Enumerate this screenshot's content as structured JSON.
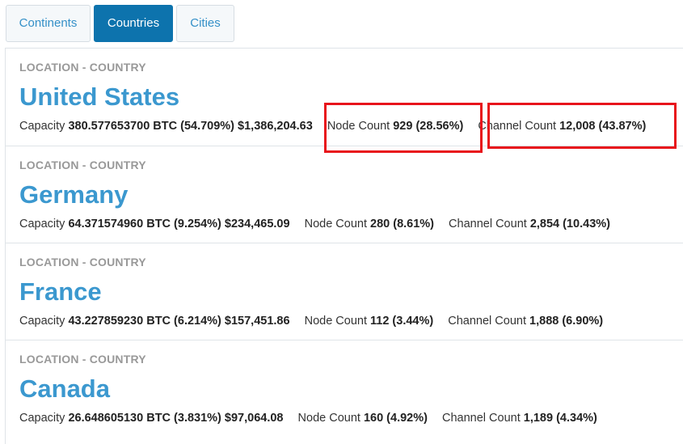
{
  "tabs": [
    {
      "label": "Continents",
      "active": false
    },
    {
      "label": "Countries",
      "active": true
    },
    {
      "label": "Cities",
      "active": false
    }
  ],
  "rows": [
    {
      "type_label": "LOCATION - COUNTRY",
      "name": "United States",
      "capacity_label": "Capacity",
      "capacity_btc": "380.577653700 BTC (54.709%)",
      "capacity_usd": "$1,386,204.63",
      "node_label": "Node Count",
      "node_value": "929 (28.56%)",
      "channel_label": "Channel Count",
      "channel_value": "12,008 (43.87%)"
    },
    {
      "type_label": "LOCATION - COUNTRY",
      "name": "Germany",
      "capacity_label": "Capacity",
      "capacity_btc": "64.371574960 BTC (9.254%)",
      "capacity_usd": "$234,465.09",
      "node_label": "Node Count",
      "node_value": "280 (8.61%)",
      "channel_label": "Channel Count",
      "channel_value": "2,854 (10.43%)"
    },
    {
      "type_label": "LOCATION - COUNTRY",
      "name": "France",
      "capacity_label": "Capacity",
      "capacity_btc": "43.227859230 BTC (6.214%)",
      "capacity_usd": "$157,451.86",
      "node_label": "Node Count",
      "node_value": "112 (3.44%)",
      "channel_label": "Channel Count",
      "channel_value": "1,888 (6.90%)"
    },
    {
      "type_label": "LOCATION - COUNTRY",
      "name": "Canada",
      "capacity_label": "Capacity",
      "capacity_btc": "26.648605130 BTC (3.831%)",
      "capacity_usd": "$97,064.08",
      "node_label": "Node Count",
      "node_value": "160 (4.92%)",
      "channel_label": "Channel Count",
      "channel_value": "1,189 (4.34%)"
    }
  ],
  "colors": {
    "active_tab": "#0d73ad",
    "link": "#3b98cf",
    "highlight": "#e8141b"
  }
}
